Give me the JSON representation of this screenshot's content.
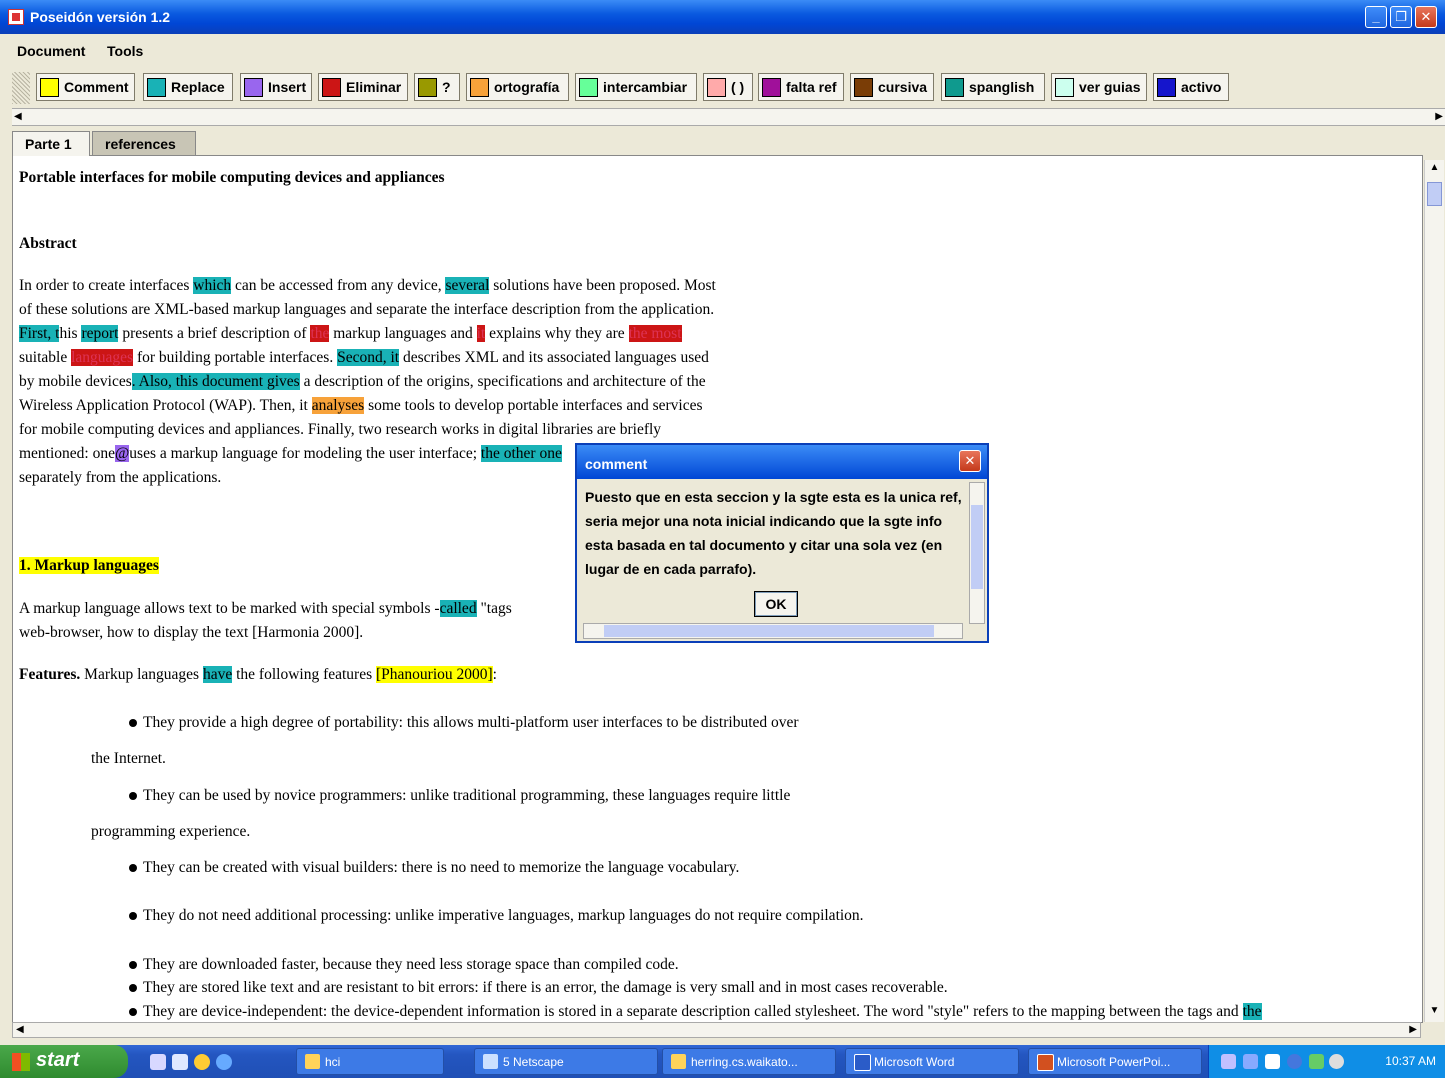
{
  "window": {
    "title": "Poseidón versión 1.2"
  },
  "menu": [
    "Document",
    "Tools"
  ],
  "toolbar": [
    {
      "label": "Comment",
      "color": "#ffff00"
    },
    {
      "label": "Replace",
      "color": "#19b2b6"
    },
    {
      "label": "Insert",
      "color": "#9966ee"
    },
    {
      "label": "Eliminar",
      "color": "#cc1515"
    },
    {
      "label": "?",
      "color": "#999900"
    },
    {
      "label": "ortografía",
      "color": "#f7a23a"
    },
    {
      "label": "intercambiar",
      "color": "#66ff99"
    },
    {
      "label": "( )",
      "color": "#ffaaaa"
    },
    {
      "label": "falta ref",
      "color": "#a0109a"
    },
    {
      "label": "cursiva",
      "color": "#7a3d06"
    },
    {
      "label": "spanglish",
      "color": "#0f9a8e"
    },
    {
      "label": "ver guias",
      "color": "#ccffee"
    },
    {
      "label": "activo",
      "color": "#1515cc"
    }
  ],
  "tabs": [
    "Parte 1",
    "references"
  ],
  "doc": {
    "title": "Portable interfaces for mobile computing devices and appliances",
    "abstract_heading": "Abstract",
    "section1": "1. Markup languages",
    "features_label": "Features.",
    "bullets": [
      "They provide a high degree of portability: this allows multi-platform user interfaces to be distributed over",
      "They can be used by novice programmers: unlike traditional programming, these languages require little",
      "They can be created with visual builders: there is no need to memorize the language vocabulary.",
      "They do not need additional processing: unlike imperative languages, markup languages do not require compilation.",
      "They are downloaded faster, because they need less storage space than compiled code.",
      "They are stored like text and are resistant to bit errors: if there is an error, the damage is very small and in  most cases recoverable.",
      "They are device-independent: the device-dependent information is stored in a separate description called stylesheet. The word \"style\" refers to the mapping between the tags and"
    ],
    "cont1": "the Internet.",
    "cont2": "programming experience."
  },
  "dialog": {
    "title": "comment",
    "text": "Puesto que en esta seccion y la sgte esta es la unica ref, seria mejor una nota inicial indicando que la sgte info esta basada en tal documento y citar una sola vez (en lugar de en cada parrafo).",
    "ok": "OK"
  },
  "taskbar": {
    "start": "start",
    "tasks": [
      "hci",
      "5 Netscape",
      "herring.cs.waikato...",
      "Microsoft Word",
      "Microsoft PowerPoi..."
    ],
    "clock": "10:37 AM"
  }
}
